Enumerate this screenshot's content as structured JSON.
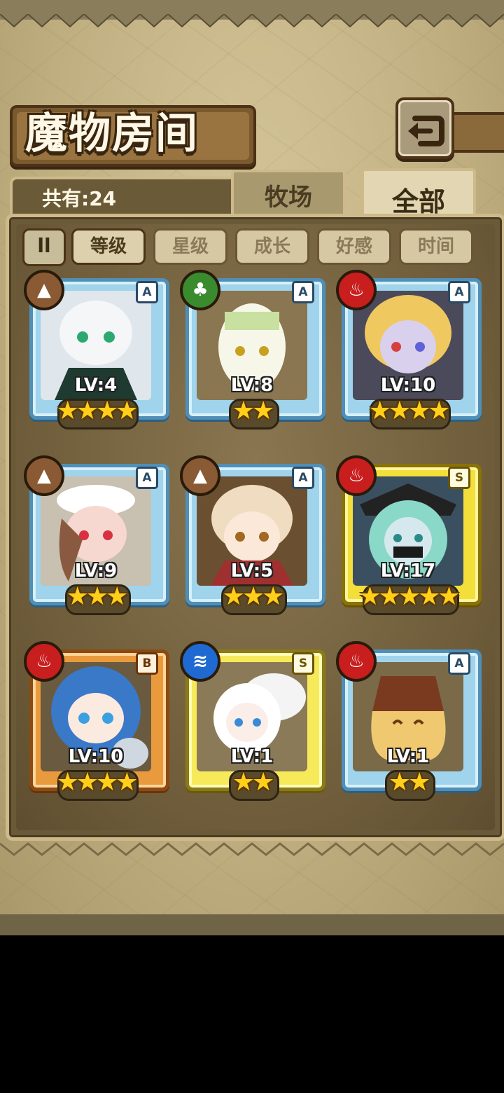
{
  "header": {
    "title": "魔物房间"
  },
  "count_label": "共有:24",
  "tabs": [
    {
      "label": "牧场",
      "active": false
    },
    {
      "label": "全部",
      "active": true
    }
  ],
  "sort": {
    "toggle_icon": "ll",
    "options": [
      "等级",
      "星级",
      "成长",
      "好感",
      "时间"
    ],
    "active_index": 0
  },
  "monsters": [
    {
      "level": "LV:4",
      "stars": "★★★★",
      "rarity": "A",
      "element": "earth",
      "frame": "blue"
    },
    {
      "level": "LV:8",
      "stars": "★★",
      "rarity": "A",
      "element": "wood",
      "frame": "blue"
    },
    {
      "level": "LV:10",
      "stars": "★★★★",
      "rarity": "A",
      "element": "fire",
      "frame": "blue"
    },
    {
      "level": "LV:9",
      "stars": "★★★",
      "rarity": "A",
      "element": "earth",
      "frame": "blue"
    },
    {
      "level": "LV:5",
      "stars": "★★★",
      "rarity": "A",
      "element": "earth",
      "frame": "blue"
    },
    {
      "level": "LV:17",
      "stars": "★★★★★",
      "rarity": "S",
      "element": "fire",
      "frame": "gold"
    },
    {
      "level": "LV:10",
      "stars": "★★★★",
      "rarity": "B",
      "element": "fire",
      "frame": "orange"
    },
    {
      "level": "LV:1",
      "stars": "★★",
      "rarity": "S",
      "element": "water",
      "frame": "yellow"
    },
    {
      "level": "LV:1",
      "stars": "★★",
      "rarity": "A",
      "element": "fire",
      "frame": "blue"
    }
  ],
  "colors": {
    "earth": "#8a5a34",
    "wood": "#3a8a2e",
    "fire": "#c81e1e",
    "water": "#1e6ad2",
    "frame_blue": "#9fd4ec",
    "frame_gold": "#f4de3a",
    "frame_orange": "#e99a3c",
    "frame_yellow": "#f6ea5a"
  },
  "icons": {
    "back": "back-arrow-icon",
    "earth": "earth-element-icon",
    "wood": "leaf-element-icon",
    "fire": "fire-element-icon",
    "water": "water-element-icon"
  }
}
